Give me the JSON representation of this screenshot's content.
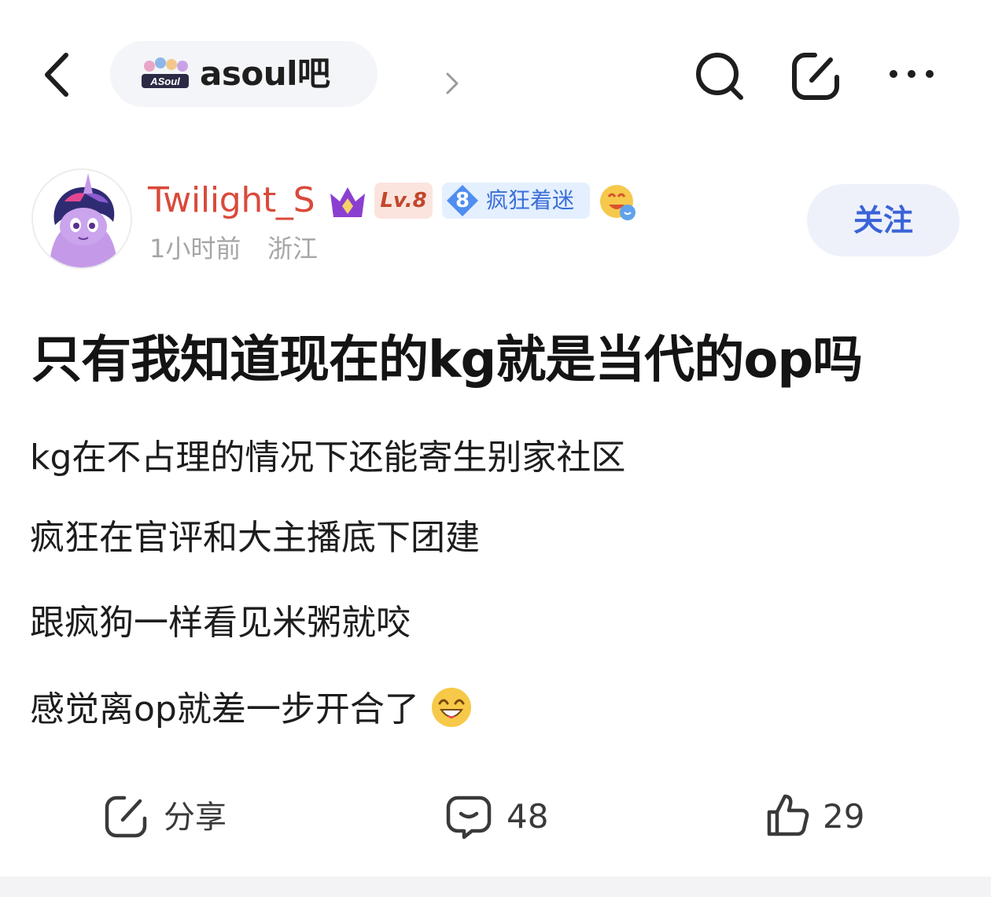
{
  "header": {
    "back_icon": "chevron-left-icon",
    "forum_name": "asoul吧",
    "forum_logo_text": "ASoul",
    "forum_chevron_icon": "chevron-right-icon",
    "search_icon": "search-icon",
    "edit_icon": "compose-icon",
    "more_icon": "more-dots-icon"
  },
  "author": {
    "name": "Twilight_S",
    "level": "Lv.8",
    "fan_level": "8",
    "fan_title": "疯狂着迷",
    "time": "1小时前",
    "location": "浙江",
    "follow_label": "关注",
    "name_color": "#d94a3b",
    "follow_color": "#3a63d8"
  },
  "post": {
    "title": "只有我知道现在的kg就是当代的op吗",
    "lines": [
      "kg在不占理的情况下还能寄生别家社区",
      "疯狂在官评和大主播底下团建",
      "跟疯狗一样看见米粥就咬",
      "感觉离op就差一步开合了"
    ],
    "trailing_emoji": "laughing-face-emoji"
  },
  "actions": {
    "share_label": "分享",
    "comment_count": "48",
    "like_count": "29"
  }
}
